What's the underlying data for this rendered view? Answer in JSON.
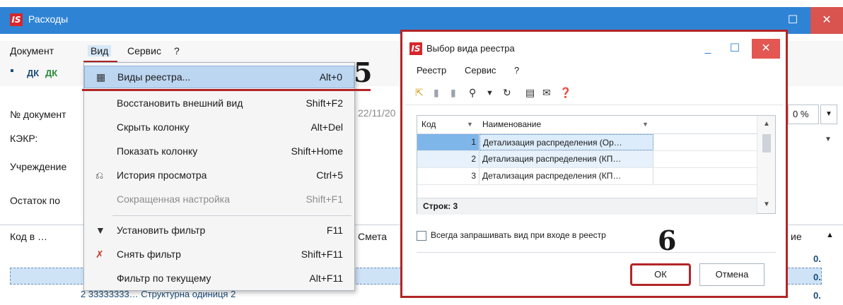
{
  "window": {
    "title": "Расходы",
    "logo": "IS",
    "maximize_glyph": "☐",
    "close_glyph": "✕"
  },
  "menubar": {
    "items": [
      "Документ",
      "Вид",
      "Сервис",
      "?"
    ]
  },
  "toolbar": {
    "save_glyph": "▪",
    "dk_label": "ДК",
    "dk2_label": "ДК"
  },
  "form": {
    "doc_number_label": "№ документ",
    "date_value": "22/11/20",
    "kekr_label": "КЭКР:",
    "institution_label": "Учреждение",
    "balance_label": "Остаток по",
    "pct_value": "0",
    "pct_symbol": "%"
  },
  "grid": {
    "header_code": "Код в …",
    "header_smeta": "Смета",
    "header_right": "ие",
    "visible_row": "2 33333333… Структурна одиниця 2",
    "right_values": [
      "0.",
      "0.",
      "0."
    ]
  },
  "view_menu": {
    "items": [
      {
        "label": "Виды реестра...",
        "shortcut": "Alt+0",
        "icon": "▦",
        "highlight": true,
        "disabled": false
      },
      {
        "label": "Восстановить внешний вид",
        "shortcut": "Shift+F2",
        "icon": "",
        "highlight": false,
        "disabled": false
      },
      {
        "label": "Скрыть колонку",
        "shortcut": "Alt+Del",
        "icon": "",
        "highlight": false,
        "disabled": false
      },
      {
        "label": "Показать колонку",
        "shortcut": "Shift+Home",
        "icon": "",
        "highlight": false,
        "disabled": false
      },
      {
        "label": "История просмотра",
        "shortcut": "Ctrl+5",
        "icon": "⎌",
        "highlight": false,
        "disabled": false
      },
      {
        "label": "Сокращенная настройка",
        "shortcut": "Shift+F1",
        "icon": "",
        "highlight": false,
        "disabled": true
      },
      {
        "label": "Установить фильтр",
        "shortcut": "F11",
        "icon": "▼",
        "highlight": false,
        "disabled": false
      },
      {
        "label": "Снять фильтр",
        "shortcut": "Shift+F11",
        "icon": "✗",
        "highlight": false,
        "disabled": false
      },
      {
        "label": "Фильтр по текущему",
        "shortcut": "Alt+F11",
        "icon": "",
        "highlight": false,
        "disabled": false
      }
    ]
  },
  "annotations": {
    "step5": "5",
    "step6": "6"
  },
  "dialog": {
    "title": "Выбор вида реестра",
    "logo": "IS",
    "minimize_glyph": "_",
    "maximize_glyph": "☐",
    "close_glyph": "✕",
    "menu": [
      "Реестр",
      "Сервис",
      "?"
    ],
    "toolbar_glyphs": [
      "⇱",
      "▮",
      "▮",
      "⚲",
      "▼",
      "↻",
      "▤",
      "✉",
      "❓"
    ],
    "grid": {
      "col_code": "Код",
      "col_name": "Наименование",
      "sort_glyph": "▼",
      "filter_glyph": "▼",
      "rows": [
        {
          "code": "1",
          "name": "Детализация распределения (Ор…"
        },
        {
          "code": "2",
          "name": "Детализация распределения (КП…"
        },
        {
          "code": "3",
          "name": "Детализация распределения (КП…"
        }
      ],
      "footer": "Строк: 3"
    },
    "checkbox_label": "Всегда запрашивать вид при входе в реестр",
    "ok_label": "ОК",
    "cancel_label": "Отмена"
  },
  "colors": {
    "titlebar": "#2f83d4",
    "accent_red": "#b22527",
    "highlight": "#bcd6f1"
  }
}
